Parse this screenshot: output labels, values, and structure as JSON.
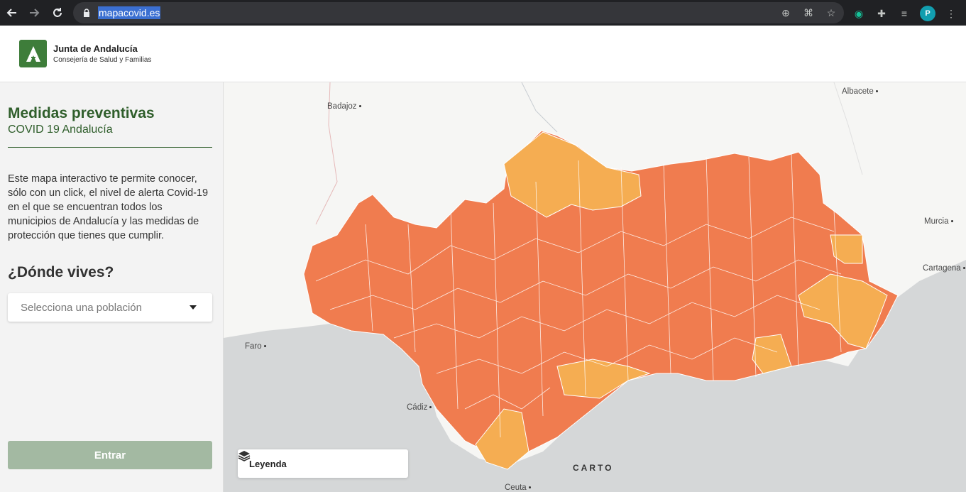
{
  "browser": {
    "url": "mapacovid.es",
    "avatar_letter": "P"
  },
  "header": {
    "org_name": "Junta de Andalucía",
    "org_sub": "Consejería de Salud y Familias",
    "logo_letter": "A"
  },
  "sidebar": {
    "title": "Medidas preventivas",
    "subtitle": "COVID 19 Andalucía",
    "description": "Este mapa interactivo te permite conocer, sólo con un click, el nivel de alerta Covid-19 en el que se encuentran todos los municipios de Andalucía y las medidas de protección que tienes que cumplir.",
    "question": "¿Dónde vives?",
    "select_placeholder": "Selecciona una población",
    "enter_label": "Entrar"
  },
  "map": {
    "cities": {
      "badajoz": "Badajoz",
      "albacete": "Albacete",
      "murcia": "Murcia",
      "cartagena": "Cartagena",
      "faro": "Faro",
      "cadiz": "Cádiz",
      "ceuta": "Ceuta"
    },
    "legend_label": "Leyenda",
    "attribution": "CARTO",
    "colors": {
      "high_alert": "#f07c4f",
      "medium_alert": "#f5ad52",
      "sea": "#d5d7d8",
      "land": "#f6f6f4"
    }
  }
}
